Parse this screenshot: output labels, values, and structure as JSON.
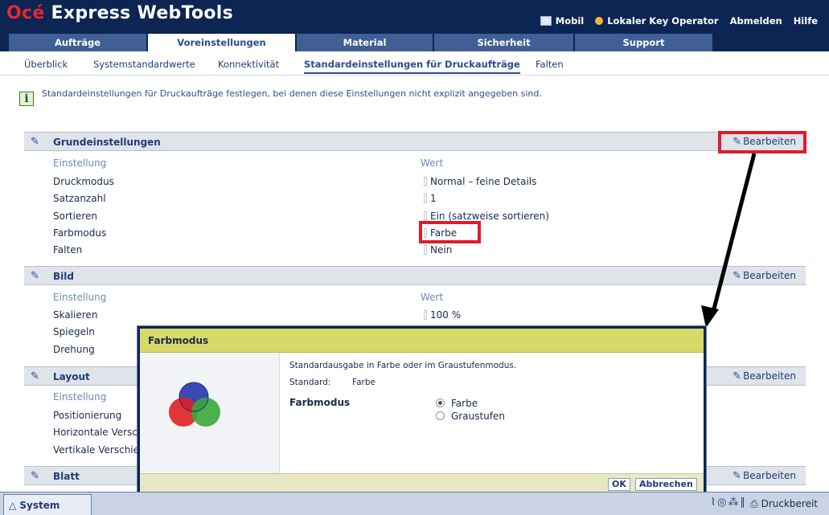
{
  "header": {
    "brand": "Océ",
    "app_title": "Express WebTools",
    "links": {
      "mobile": "Mobil",
      "operator": "Lokaler Key Operator",
      "logout": "Abmelden",
      "help": "Hilfe"
    }
  },
  "tabs": [
    {
      "label": "Aufträge"
    },
    {
      "label": "Voreinstellungen",
      "active": true
    },
    {
      "label": "Material"
    },
    {
      "label": "Sicherheit"
    },
    {
      "label": "Support"
    }
  ],
  "subtabs": [
    {
      "label": "Überblick"
    },
    {
      "label": "Systemstandardwerte"
    },
    {
      "label": "Konnektivität"
    },
    {
      "label": "Standardeinstellungen für Druckaufträge",
      "active": true
    },
    {
      "label": "Falten"
    }
  ],
  "info_text": "Standardeinstellungen für Druckaufträge festlegen, bei denen diese Einstellungen nicht explizit angegeben sind.",
  "edit_label": "Bearbeiten",
  "col_setting": "Einstellung",
  "col_value": "Wert",
  "sections": {
    "grund": {
      "title": "Grundeinstellungen",
      "rows": [
        {
          "label": "Druckmodus",
          "value": "Normal – feine Details"
        },
        {
          "label": "Satzanzahl",
          "value": "1"
        },
        {
          "label": "Sortieren",
          "value": "Ein (satzweise sortieren)"
        },
        {
          "label": "Farbmodus",
          "value": "Farbe"
        },
        {
          "label": "Falten",
          "value": "Nein"
        }
      ]
    },
    "bild": {
      "title": "Bild",
      "rows": [
        {
          "label": "Skalieren",
          "value": "100 %"
        },
        {
          "label": "Spiegeln",
          "value": ""
        },
        {
          "label": "Drehung",
          "value": ""
        }
      ]
    },
    "layout": {
      "title": "Layout",
      "rows": [
        {
          "label": "Positionierung",
          "value": ""
        },
        {
          "label": "Horizontale Versch",
          "value": ""
        },
        {
          "label": "Vertikale Verschie",
          "value": ""
        }
      ]
    },
    "blatt": {
      "title": "Blatt"
    }
  },
  "dialog": {
    "title": "Farbmodus",
    "description": "Standardausgabe in Farbe oder im Graustufenmodus.",
    "standard_label": "Standard:",
    "standard_value": "Farbe",
    "field_label": "Farbmodus",
    "options": [
      {
        "label": "Farbe",
        "checked": true
      },
      {
        "label": "Graustufen",
        "checked": false
      }
    ],
    "ok_label": "OK",
    "cancel_label": "Abbrechen"
  },
  "status": {
    "system_tab": "System",
    "printer_status": "Druckbereit"
  },
  "colors": {
    "header_bg": "#0c2552",
    "tab_bg": "#3f5f95",
    "brand_red": "#e8262c",
    "highlight_red": "#e01b2a",
    "dialog_title_bg": "#d9d96a"
  }
}
